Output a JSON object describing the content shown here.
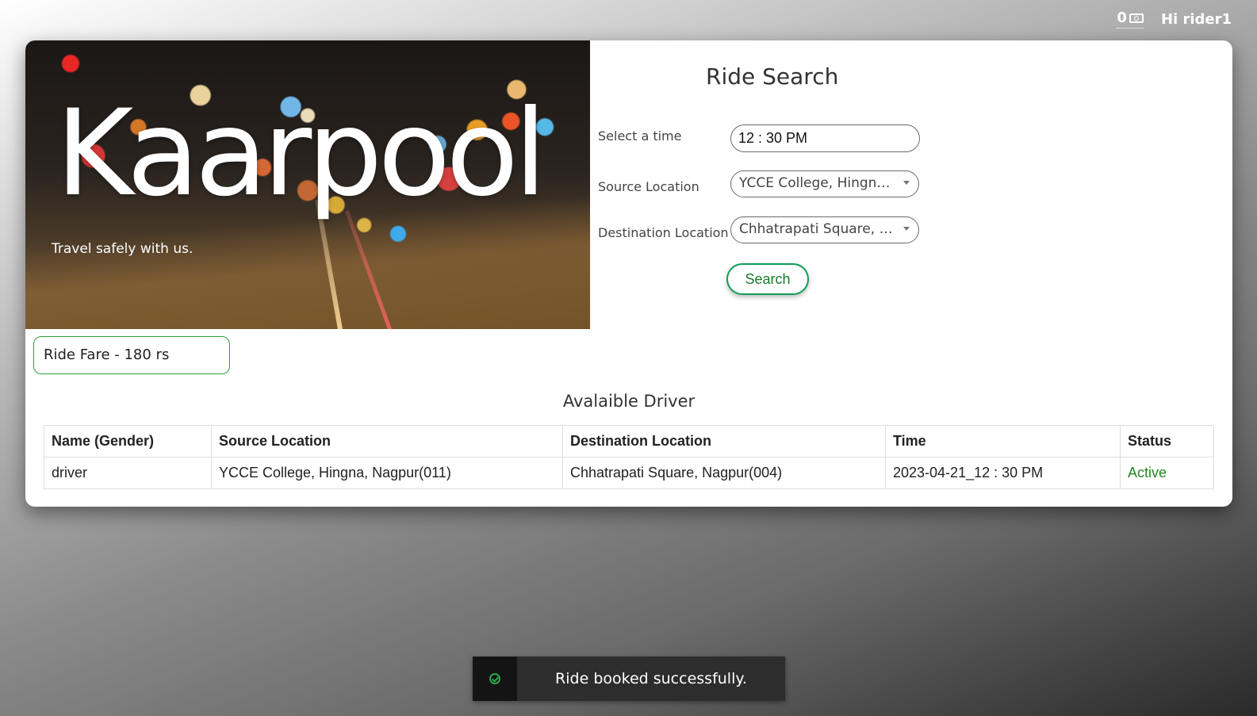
{
  "header": {
    "wallet_balance": "0",
    "greeting": "Hi rider1"
  },
  "hero": {
    "brand": "Kaarpool",
    "tagline": "Travel safely with us."
  },
  "search": {
    "title": "Ride Search",
    "time_label": "Select a time",
    "time_value": "12 : 30 PM",
    "source_label": "Source Location",
    "source_value": "YCCE College, Hingna, Nagpur(011)",
    "destination_label": "Destination Location",
    "destination_value": "Chhatrapati Square, Nagpur(004)",
    "button_label": "Search"
  },
  "fare": {
    "text": "Ride Fare - 180 rs"
  },
  "drivers": {
    "title": "Avalaible Driver",
    "columns": [
      "Name (Gender)",
      "Source Location",
      "Destination Location",
      "Time",
      "Status"
    ],
    "rows": [
      {
        "name": "driver",
        "source": "YCCE College, Hingna, Nagpur(011)",
        "destination": "Chhatrapati Square, Nagpur(004)",
        "time": "2023-04-21_12 : 30 PM",
        "status": "Active"
      }
    ]
  },
  "toast": {
    "icon": "check-circle-icon",
    "message": "Ride booked successfully."
  },
  "colors": {
    "accent_green": "#0f9d58",
    "status_active": "#1e8a1e",
    "toast_bg": "#2d2d2d"
  }
}
